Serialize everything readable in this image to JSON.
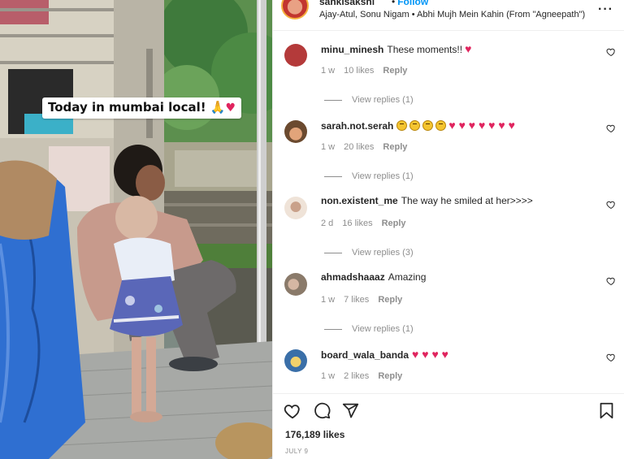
{
  "media": {
    "caption_text": "Today in mumbai local!",
    "caption_emojis": [
      "folded-hands",
      "red-heart"
    ]
  },
  "header": {
    "username": "sankisakshi",
    "follow_label": "Follow",
    "separator": "•",
    "audio": "Ajay-Atul, Sonu Nigam • Abhi Mujh Mein Kahin (From \"Agneepath\")",
    "more_label": "···"
  },
  "comments": [
    {
      "username": "minu_minesh",
      "text": "These moments!!",
      "emojis": [
        "red-heart"
      ],
      "time": "1 w",
      "likes": "10 likes",
      "reply_label": "Reply",
      "view_replies": "View replies (1)",
      "avatar_color": "#b43a3a"
    },
    {
      "username": "sarah.not.serah",
      "text": "",
      "emojis": [
        "grimace-face",
        "grimace-face",
        "grimace-face",
        "grimace-face",
        "red-heart",
        "red-heart",
        "red-heart",
        "red-heart",
        "red-heart",
        "red-heart",
        "red-heart"
      ],
      "time": "1 w",
      "likes": "20 likes",
      "reply_label": "Reply",
      "view_replies": "View replies (1)",
      "avatar_color": "#6b4a2f"
    },
    {
      "username": "non.existent_me",
      "text": "The way he smiled at her>>>>",
      "emojis": [],
      "time": "2 d",
      "likes": "16 likes",
      "reply_label": "Reply",
      "view_replies": "View replies (3)",
      "avatar_color": "#d8b8a0"
    },
    {
      "username": "ahmadshaaaz",
      "text": "Amazing",
      "emojis": [],
      "time": "1 w",
      "likes": "7 likes",
      "reply_label": "Reply",
      "view_replies": "View replies (1)",
      "avatar_color": "#8a7a6a"
    },
    {
      "username": "board_wala_banda",
      "text": "",
      "emojis": [
        "red-heart",
        "red-heart",
        "red-heart",
        "red-heart"
      ],
      "time": "1 w",
      "likes": "2 likes",
      "reply_label": "Reply",
      "view_replies": "",
      "avatar_color": "#3a6fa8"
    }
  ],
  "actions": {
    "icons": [
      "heart-outline-icon",
      "comment-icon",
      "share-icon",
      "bookmark-icon"
    ]
  },
  "likes_count": "176,189 likes",
  "post_date": "JULY 9",
  "colors": {
    "link_blue": "#0095f6",
    "heart_red": "#e0245e",
    "muted_text": "#8e8e8e",
    "tarp_blue": "#2f6fd1"
  }
}
